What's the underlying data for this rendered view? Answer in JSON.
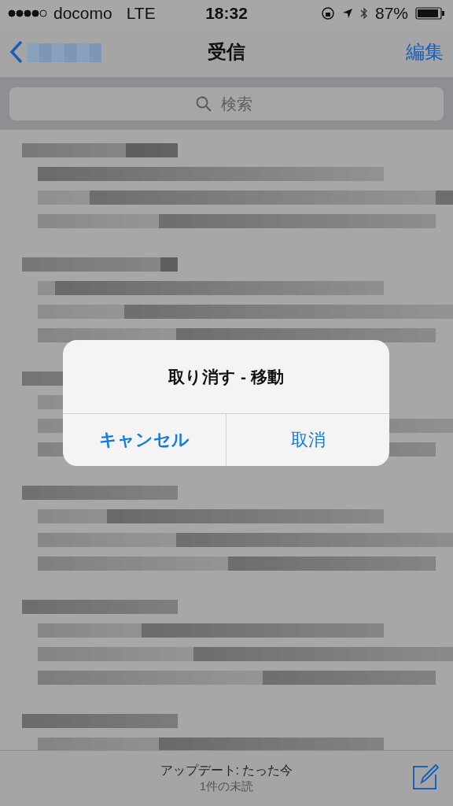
{
  "status_bar": {
    "carrier": "docomo",
    "network": "LTE",
    "time": "18:32",
    "battery": "87%"
  },
  "nav": {
    "title": "受信",
    "edit": "編集"
  },
  "search": {
    "placeholder": "検索"
  },
  "alert": {
    "title": "取り消す - 移動",
    "buttons": [
      {
        "label": "キャンセル",
        "kind": "cancel"
      },
      {
        "label": "取消",
        "kind": "default"
      }
    ]
  },
  "toolbar": {
    "updated": "アップデート: たった今",
    "unread": "1件の未読"
  }
}
